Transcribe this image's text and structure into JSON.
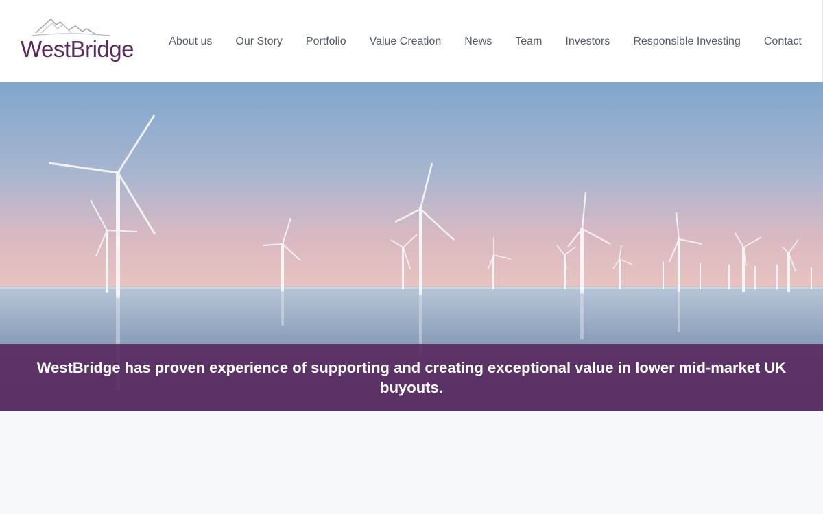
{
  "brand": {
    "name": "WestBridge",
    "color": "#5a2a5e"
  },
  "nav": {
    "items": [
      {
        "label": "About us"
      },
      {
        "label": "Our Story"
      },
      {
        "label": "Portfolio"
      },
      {
        "label": "Value Creation"
      },
      {
        "label": "News"
      },
      {
        "label": "Team"
      },
      {
        "label": "Investors"
      },
      {
        "label": "Responsible Investing"
      },
      {
        "label": "Contact"
      }
    ]
  },
  "hero": {
    "image": "offshore-wind-farm-image",
    "headline": "WestBridge has proven experience of supporting and creating exceptional value in lower mid-market UK buyouts.",
    "overlay_color": "#56265c"
  }
}
